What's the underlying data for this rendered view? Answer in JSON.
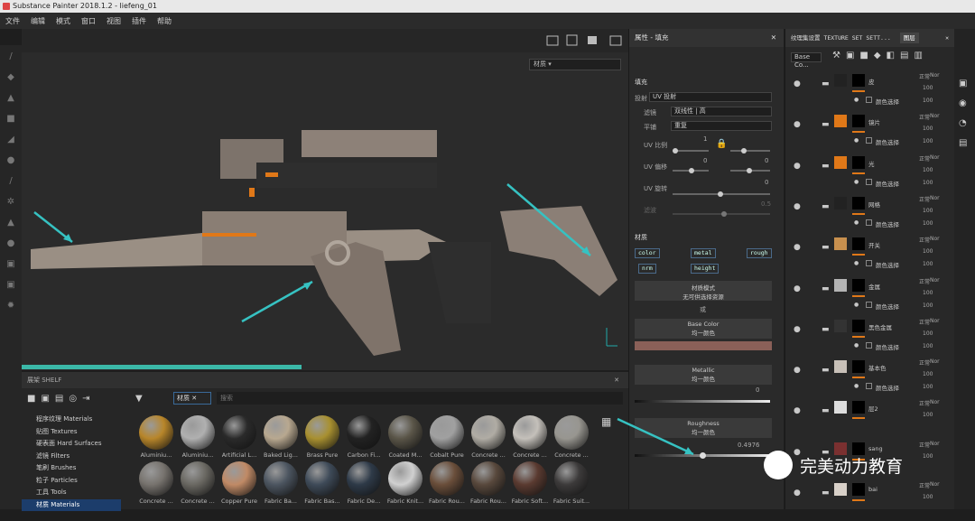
{
  "window": {
    "title": "Substance Painter 2018.1.2 - liefeng_01"
  },
  "menu": [
    "文件",
    "编辑",
    "模式",
    "窗口",
    "视图",
    "插件",
    "帮助"
  ],
  "viewport": {
    "material_dropdown": "材质"
  },
  "shelf": {
    "title": "展架 SHELF",
    "filter_tag": "材质",
    "search_placeholder": "搜索",
    "categories": [
      "程序纹理 Materials",
      "贴图 Textures",
      "硬表面 Hard Surfaces",
      "滤镜 Filters",
      "笔刷 Brushes",
      "粒子 Particles",
      "工具 Tools",
      "材质 Materials"
    ],
    "materials": [
      "Aluminiu...",
      "Aluminiu...",
      "Artificial L...",
      "Baked Lig...",
      "Brass Pure",
      "Carbon Fi...",
      "Coated M...",
      "Cobalt Pure",
      "Concrete ...",
      "Concrete ...",
      "Concrete ...",
      "Concrete ...",
      "Concrete ...",
      "Copper Pure",
      "Fabric Ba...",
      "Fabric Bas...",
      "Fabric De...",
      "Fabric Knit...",
      "Fabric Rou...",
      "Fabric Rou...",
      "Fabric Soft...",
      "Fabric Suit..."
    ],
    "ball_colors": [
      "#b8862a",
      "#b0b0b0",
      "#2a2a2a",
      "#b8a890",
      "#a89030",
      "#222",
      "#5a5548",
      "#a0a0a0",
      "#b0aca4",
      "#c4c0ba",
      "#989690",
      "#77736e",
      "#6a6862",
      "#c08a66",
      "#4c5560",
      "#3e4a58",
      "#2e3a48",
      "#d0d0d0",
      "#6a4e3a",
      "#58483c",
      "#5a3a30",
      "#3c3a3a"
    ]
  },
  "props": {
    "title": "属性 - 填充",
    "section_fill": "填充",
    "projection_label": "投射",
    "projection_value": "UV 投射",
    "filter_label": "滤镜",
    "filter_value": "双线性 | 高",
    "tiling_label": "平铺",
    "tiling_value": "重复",
    "uv_scale_label": "UV 比例",
    "uv_scale_value": "1",
    "uv_offset_label": "UV 偏移",
    "uv_offset_v1": "0",
    "uv_offset_v2": "0",
    "uv_rotate_label": "UV 旋转",
    "uv_rotate_value": "0",
    "blur_label": "滤波",
    "blur_value": "0.5",
    "section_material": "材质",
    "channels": [
      "color",
      "metal",
      "rough",
      "nrm",
      "height"
    ],
    "material_mode": "材质模式",
    "material_mode_sub": "无可供选择资源",
    "or_label": "或",
    "base_color": "Base Color",
    "base_color_sub": "均一颜色",
    "base_color_hex": "#8a6058",
    "metallic": "Metallic",
    "metallic_sub": "均一颜色",
    "metallic_value": "0",
    "roughness": "Roughness",
    "roughness_sub": "均一颜色",
    "roughness_value": "0.4976",
    "roughness_fraction": 0.4976
  },
  "layers": {
    "tab_texture": "纹理集设置 TEXTURE SET SETT...",
    "tab_layers": "图层",
    "blend_select": "Base Co...",
    "blend_mode": "正常",
    "opacity": "100",
    "norm_short": "Nor",
    "items": [
      {
        "name": "皮",
        "sub": "颜色选择",
        "thumb": "#222"
      },
      {
        "name": "镜片",
        "sub": "颜色选择",
        "thumb": "#e07818"
      },
      {
        "name": "光",
        "sub": "颜色选择",
        "thumb": "#e07818"
      },
      {
        "name": "网格",
        "sub": "颜色选择",
        "thumb": "#222"
      },
      {
        "name": "开关",
        "sub": "颜色选择",
        "thumb": "#c8904e"
      },
      {
        "name": "金属",
        "sub": "颜色选择",
        "thumb": "#b4b4b4"
      },
      {
        "name": "黑色金属",
        "sub": "颜色选择",
        "thumb": "#333"
      },
      {
        "name": "基本色",
        "sub": "颜色选择",
        "thumb": "#c8c0b8"
      },
      {
        "name": "层2",
        "sub": "",
        "thumb": "#ddd"
      },
      {
        "name": "sang",
        "sub": "",
        "thumb": "#7a3030"
      },
      {
        "name": "bai",
        "sub": "",
        "thumb": "#d8d0c8"
      }
    ]
  },
  "watermark": "完美动力教育"
}
